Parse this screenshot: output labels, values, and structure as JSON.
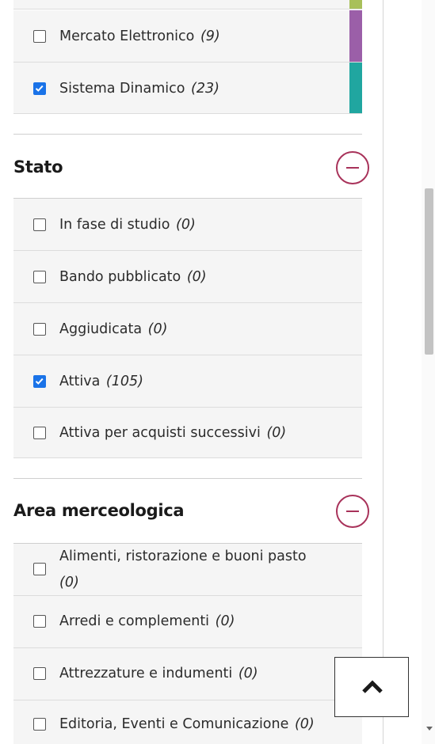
{
  "tipologia": {
    "items": [
      {
        "label": "Mercato Elettronico",
        "count": "(9)",
        "checked": false,
        "color": "#9b5fa8"
      },
      {
        "label": "Sistema Dinamico",
        "count": "(23)",
        "checked": true,
        "color": "#20a6a0"
      }
    ],
    "top_strip_color": "#a8c05a"
  },
  "stato": {
    "title": "Stato",
    "items": [
      {
        "label": "In fase di studio",
        "count": "(0)",
        "checked": false
      },
      {
        "label": "Bando pubblicato",
        "count": "(0)",
        "checked": false
      },
      {
        "label": "Aggiudicata",
        "count": "(0)",
        "checked": false
      },
      {
        "label": "Attiva",
        "count": "(105)",
        "checked": true
      },
      {
        "label": "Attiva per acquisti successivi",
        "count": "(0)",
        "checked": false
      }
    ]
  },
  "area": {
    "title": "Area merceologica",
    "items": [
      {
        "label": "Alimenti, ristorazione e buoni pasto",
        "count": "(0)",
        "checked": false
      },
      {
        "label": "Arredi e complementi",
        "count": "(0)",
        "checked": false
      },
      {
        "label": "Attrezzature e indumenti",
        "count": "(0)",
        "checked": false
      },
      {
        "label": "Editoria, Eventi e Comunicazione",
        "count": "(0)",
        "checked": false
      }
    ]
  },
  "colors": {
    "accent": "#a8325a",
    "checkbox_checked": "#1a73e8"
  }
}
